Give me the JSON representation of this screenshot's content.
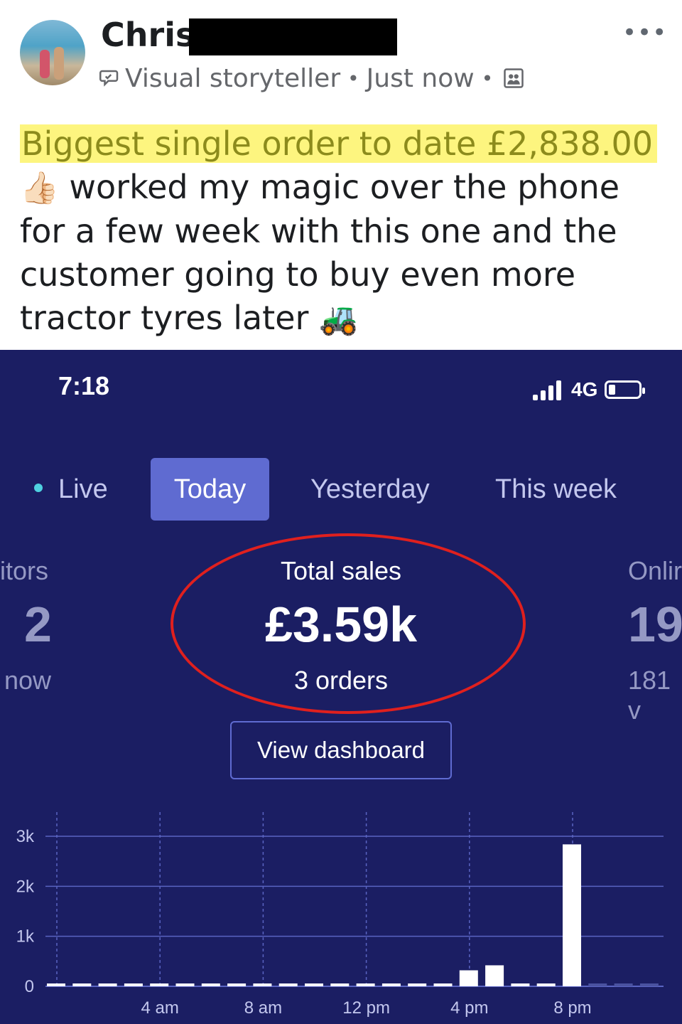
{
  "post": {
    "author_first_name": "Chris",
    "more_label": "•••",
    "role": "Visual storyteller",
    "time": "Just now",
    "separator": "•",
    "highlight_text": "Biggest single order to date £2,838.00",
    "thumb_emoji": "👍🏻",
    "body_text": " worked my magic over the phone for a few week with this one and the customer going to buy even more tractor tyres later ",
    "tractor_emoji": "🚜",
    "colors": {
      "highlight": "#fdf57f",
      "highlight_text": "#8c8b1c"
    }
  },
  "screenshot": {
    "status": {
      "time": "7:18",
      "network": "4G"
    },
    "tabs": [
      {
        "label": "Live",
        "active": false
      },
      {
        "label": "Today",
        "active": true
      },
      {
        "label": "Yesterday",
        "active": false
      },
      {
        "label": "This week",
        "active": false
      }
    ],
    "left_card": {
      "label": "itors",
      "value": "2",
      "sub": "now"
    },
    "center_card": {
      "label": "Total sales",
      "value": "£3.59k",
      "sub": "3 orders"
    },
    "right_card": {
      "label": "Onlir",
      "value": "19",
      "sub": "181 v"
    },
    "button_label": "View dashboard",
    "colors": {
      "background": "#1b1e63",
      "accent": "#5f6bd1",
      "annotation": "#e0201e"
    }
  },
  "chart_data": {
    "type": "bar",
    "title": "",
    "xlabel": "",
    "ylabel": "",
    "ylim": [
      0,
      3000
    ],
    "yticks": [
      {
        "value": 0,
        "label": "0"
      },
      {
        "value": 1000,
        "label": "1k"
      },
      {
        "value": 2000,
        "label": "2k"
      },
      {
        "value": 3000,
        "label": "3k"
      }
    ],
    "xticks": [
      {
        "hour": 0,
        "label": ""
      },
      {
        "hour": 4,
        "label": "4 am"
      },
      {
        "hour": 8,
        "label": "8 am"
      },
      {
        "hour": 12,
        "label": "12 pm"
      },
      {
        "hour": 16,
        "label": "4 pm"
      },
      {
        "hour": 20,
        "label": "8 pm"
      }
    ],
    "hours": [
      0,
      1,
      2,
      3,
      4,
      5,
      6,
      7,
      8,
      9,
      10,
      11,
      12,
      13,
      14,
      15,
      16,
      17,
      18,
      19,
      20,
      21,
      22,
      23
    ],
    "values": [
      0,
      0,
      0,
      0,
      0,
      0,
      0,
      0,
      0,
      0,
      0,
      0,
      0,
      0,
      0,
      0,
      320,
      420,
      0,
      0,
      2838,
      0,
      0,
      0
    ],
    "future_from_hour": 20
  }
}
